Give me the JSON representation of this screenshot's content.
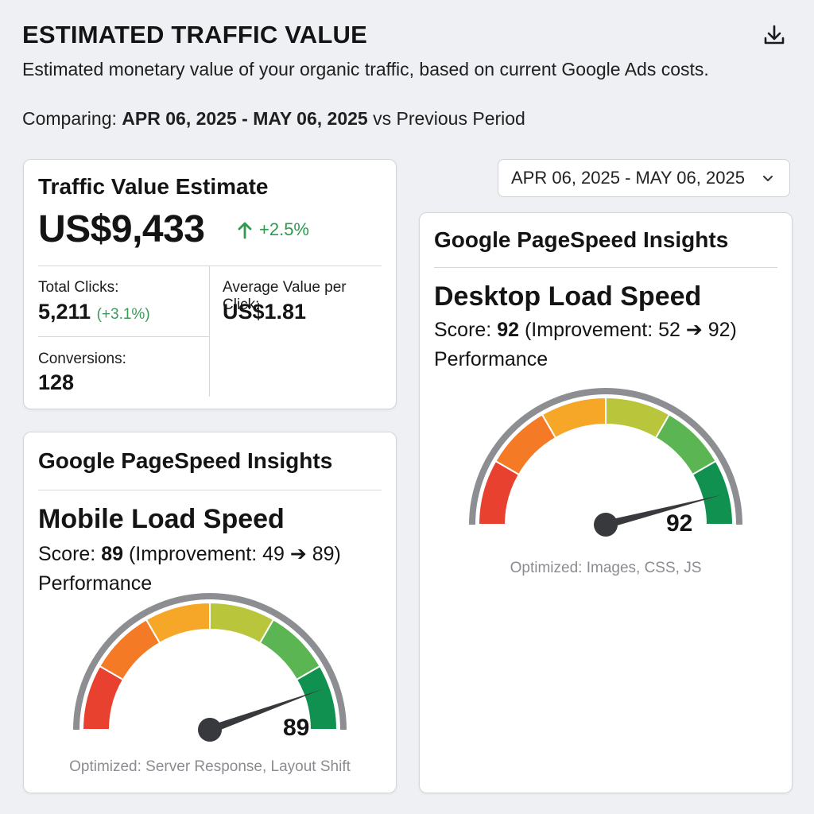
{
  "header": {
    "title": "ESTIMATED TRAFFIC VALUE",
    "subtitle": "Estimated monetary value of your organic traffic, based on current Google Ads costs.",
    "comparing_prefix": "Comparing:",
    "comparing_range": "APR 06, 2025 - MAY 06, 2025",
    "comparing_suffix": "vs Previous Period",
    "download_icon": "download-icon"
  },
  "date_picker": {
    "value": "APR 06, 2025 - MAY 06, 2025",
    "icon": "chevron-down-icon"
  },
  "traffic_card": {
    "heading": "Traffic Value Estimate",
    "value": "US$9,433",
    "change": "+2.5%",
    "change_icon": "arrow-up-icon",
    "total_clicks_label": "Total Clicks:",
    "total_clicks_value": "5,211",
    "total_clicks_change": "(+3.1%)",
    "avg_value_label": "Average Value per Click:",
    "avg_value_value": "US$1.81",
    "conversions_label": "Conversions:",
    "conversions_value": "128"
  },
  "mobile_card": {
    "heading": "Google PageSpeed Insights",
    "speed_title": "Mobile Load Speed",
    "score_label": "Score:",
    "score": "89",
    "improvement": "(Improvement: 49 ➔ 89)",
    "performance": "Performance",
    "gauge_value": "89",
    "optimized": "Optimized: Server Response, Layout Shift"
  },
  "desktop_card": {
    "heading": "Google PageSpeed Insights",
    "speed_title": "Desktop Load Speed",
    "score_label": "Score:",
    "score": "92",
    "improvement": "(Improvement: 52 ➔ 92)",
    "performance": "Performance",
    "gauge_value": "92",
    "optimized": "Optimized: Images, CSS, JS"
  },
  "gauge_colors": [
    "#e8412f",
    "#f47a26",
    "#f7a727",
    "#b9c53a",
    "#5bb552",
    "#10914f"
  ],
  "colors": {
    "positive": "#2e9a4f",
    "gauge_track": "#8c8e92",
    "needle": "#37393d"
  }
}
